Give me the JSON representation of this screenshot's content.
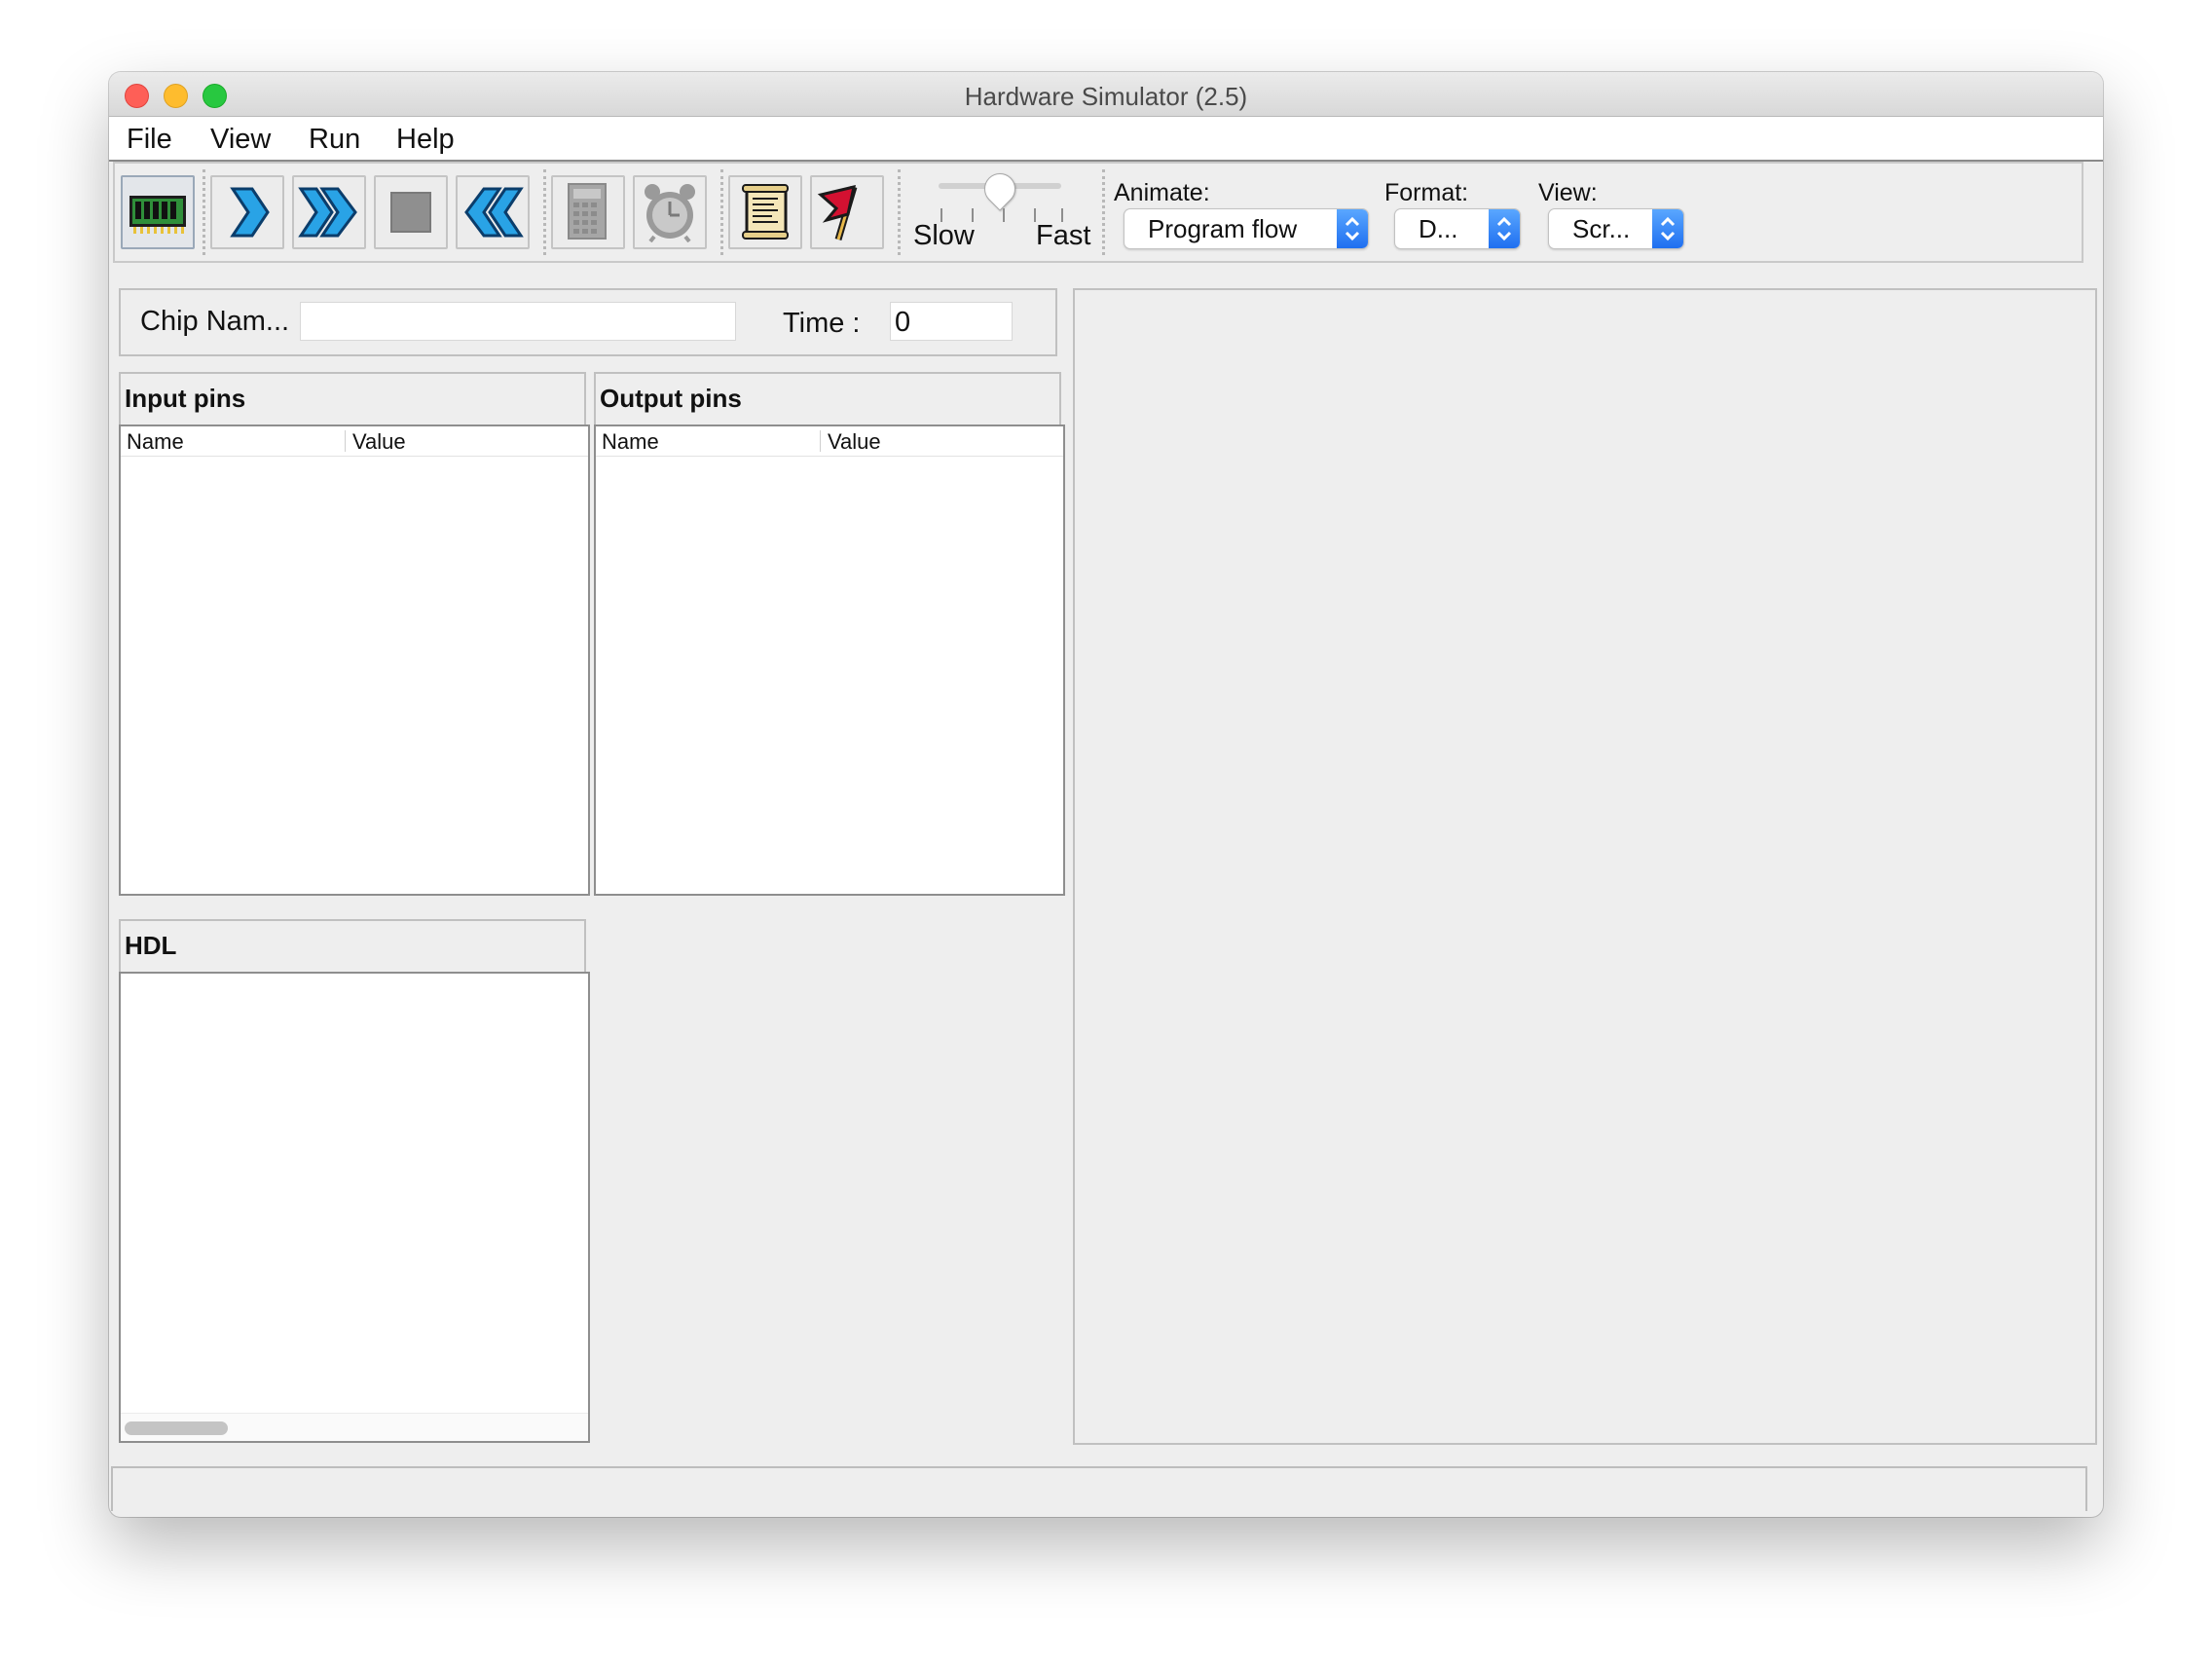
{
  "window": {
    "title": "Hardware Simulator (2.5)"
  },
  "menu": [
    "File",
    "View",
    "Run",
    "Help"
  ],
  "toolbar": {
    "buttons": [
      {
        "name": "load-chip-button",
        "icon": "chip-icon"
      },
      {
        "name": "single-step-button",
        "icon": "single-arrow-right-icon"
      },
      {
        "name": "run-button",
        "icon": "double-arrow-right-icon"
      },
      {
        "name": "stop-button",
        "icon": "stop-square-icon"
      },
      {
        "name": "reset-button",
        "icon": "double-arrow-left-icon"
      },
      {
        "name": "eval-button",
        "icon": "calculator-icon"
      },
      {
        "name": "tick-tock-button",
        "icon": "alarm-clock-icon"
      },
      {
        "name": "script-button",
        "icon": "scroll-icon"
      },
      {
        "name": "breakpoints-button",
        "icon": "red-flag-icon"
      }
    ],
    "speed": {
      "slow_label": "Slow",
      "fast_label": "Fast",
      "level": 0.5
    },
    "animate": {
      "label": "Animate:",
      "value": "Program flow"
    },
    "format": {
      "label": "Format:",
      "value": "D..."
    },
    "view": {
      "label": "View:",
      "value": "Scr..."
    }
  },
  "chip": {
    "name_label": "Chip Nam...",
    "name_value": "",
    "time_label": "Time :",
    "time_value": "0"
  },
  "input_pins": {
    "title": "Input pins",
    "columns": [
      "Name",
      "Value"
    ],
    "rows": []
  },
  "output_pins": {
    "title": "Output pins",
    "columns": [
      "Name",
      "Value"
    ],
    "rows": []
  },
  "hdl": {
    "title": "HDL"
  },
  "colors": {
    "accent_blue": "#1f6ff0",
    "arrow_blue": "#29a3e6",
    "flag_red": "#d31131"
  }
}
